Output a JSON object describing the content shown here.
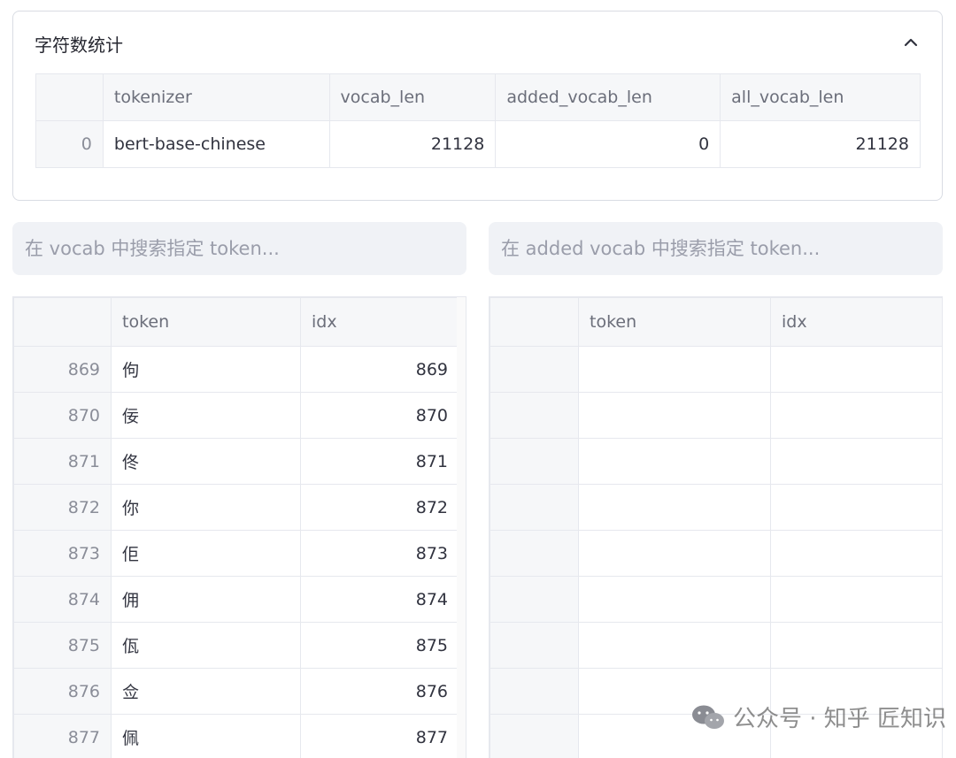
{
  "expander": {
    "title": "字符数统计",
    "columns": [
      "",
      "tokenizer",
      "vocab_len",
      "added_vocab_len",
      "all_vocab_len"
    ],
    "rows": [
      {
        "index": "0",
        "tokenizer": "bert-base-chinese",
        "vocab_len": "21128",
        "added_vocab_len": "0",
        "all_vocab_len": "21128"
      }
    ]
  },
  "search_left": {
    "placeholder": "在 vocab 中搜索指定 token..."
  },
  "search_right": {
    "placeholder": "在 added vocab 中搜索指定 token..."
  },
  "vocab_table": {
    "columns": [
      "",
      "token",
      "idx"
    ],
    "rows": [
      {
        "rid": "869",
        "token": "佝",
        "idx": "869"
      },
      {
        "rid": "870",
        "token": "佞",
        "idx": "870"
      },
      {
        "rid": "871",
        "token": "佟",
        "idx": "871"
      },
      {
        "rid": "872",
        "token": "你",
        "idx": "872"
      },
      {
        "rid": "873",
        "token": "佢",
        "idx": "873"
      },
      {
        "rid": "874",
        "token": "佣",
        "idx": "874"
      },
      {
        "rid": "875",
        "token": "佤",
        "idx": "875"
      },
      {
        "rid": "876",
        "token": "佥",
        "idx": "876"
      },
      {
        "rid": "877",
        "token": "佩",
        "idx": "877"
      }
    ]
  },
  "added_vocab_table": {
    "columns": [
      "",
      "token",
      "idx"
    ],
    "empty_rows": 9
  },
  "watermark": {
    "text": "公众号 · 知乎 匠知识"
  },
  "icons": {
    "collapse": "chevron-up-icon",
    "watermark": "wechat-icon"
  }
}
